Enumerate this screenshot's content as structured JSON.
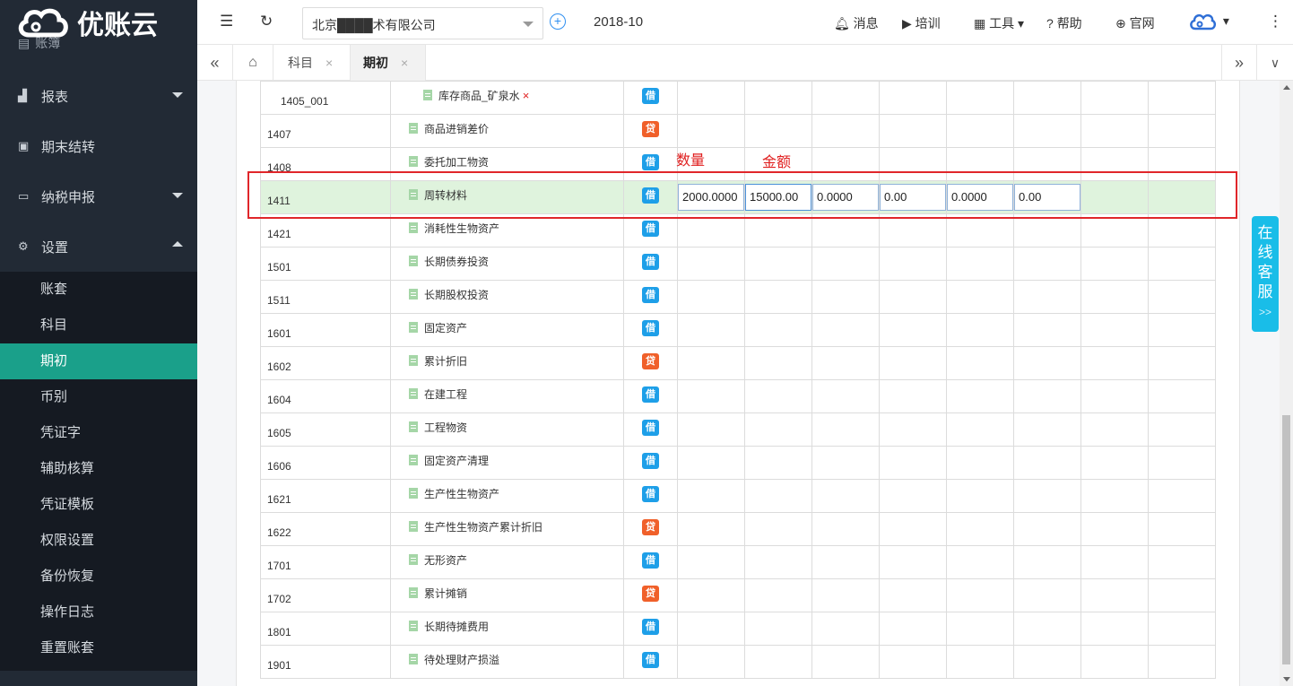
{
  "brand": {
    "name": "优账云"
  },
  "sidebar": {
    "partial_item": "账簿",
    "main_items": [
      {
        "label": "报表",
        "icon": "chart-icon"
      },
      {
        "label": "期末结转",
        "icon": "transfer-icon"
      },
      {
        "label": "纳税申报",
        "icon": "tax-icon"
      },
      {
        "label": "设置",
        "icon": "gear-icon"
      }
    ],
    "sub_items": [
      "账套",
      "科目",
      "期初",
      "币别",
      "凭证字",
      "辅助核算",
      "凭证模板",
      "权限设置",
      "备份恢复",
      "操作日志",
      "重置账套"
    ],
    "active_sub": "期初"
  },
  "topbar": {
    "company": "北京████术有限公司",
    "period": "2018-10",
    "links": [
      "消息",
      "培训",
      "工具",
      "帮助",
      "官网"
    ]
  },
  "tabs": [
    {
      "label": "科目",
      "close": "×"
    },
    {
      "label": "期初",
      "close": "×"
    }
  ],
  "annotations": {
    "quantity": "数量",
    "amount": "金额"
  },
  "chat_widget": {
    "label": "在线客服",
    "arrow": ">>"
  },
  "rows": [
    {
      "code": "1405_001",
      "name": "库存商品_矿泉水",
      "dir": "借",
      "delete": "×"
    },
    {
      "code": "1407",
      "name": "商品进销差价",
      "dir": "贷"
    },
    {
      "code": "1408",
      "name": "委托加工物资",
      "dir": "借"
    },
    {
      "code": "1411",
      "name": "周转材料",
      "dir": "借",
      "values": [
        "2000.0000",
        "15000.00",
        "0.0000",
        "0.00",
        "0.0000",
        "0.00"
      ]
    },
    {
      "code": "1421",
      "name": "消耗性生物资产",
      "dir": "借"
    },
    {
      "code": "1501",
      "name": "长期债券投资",
      "dir": "借"
    },
    {
      "code": "1511",
      "name": "长期股权投资",
      "dir": "借"
    },
    {
      "code": "1601",
      "name": "固定资产",
      "dir": "借"
    },
    {
      "code": "1602",
      "name": "累计折旧",
      "dir": "贷"
    },
    {
      "code": "1604",
      "name": "在建工程",
      "dir": "借"
    },
    {
      "code": "1605",
      "name": "工程物资",
      "dir": "借"
    },
    {
      "code": "1606",
      "name": "固定资产清理",
      "dir": "借"
    },
    {
      "code": "1621",
      "name": "生产性生物资产",
      "dir": "借"
    },
    {
      "code": "1622",
      "name": "生产性生物资产累计折旧",
      "dir": "贷"
    },
    {
      "code": "1701",
      "name": "无形资产",
      "dir": "借"
    },
    {
      "code": "1702",
      "name": "累计摊销",
      "dir": "贷"
    },
    {
      "code": "1801",
      "name": "长期待摊费用",
      "dir": "借"
    },
    {
      "code": "1901",
      "name": "待处理财产损溢",
      "dir": "借"
    }
  ]
}
